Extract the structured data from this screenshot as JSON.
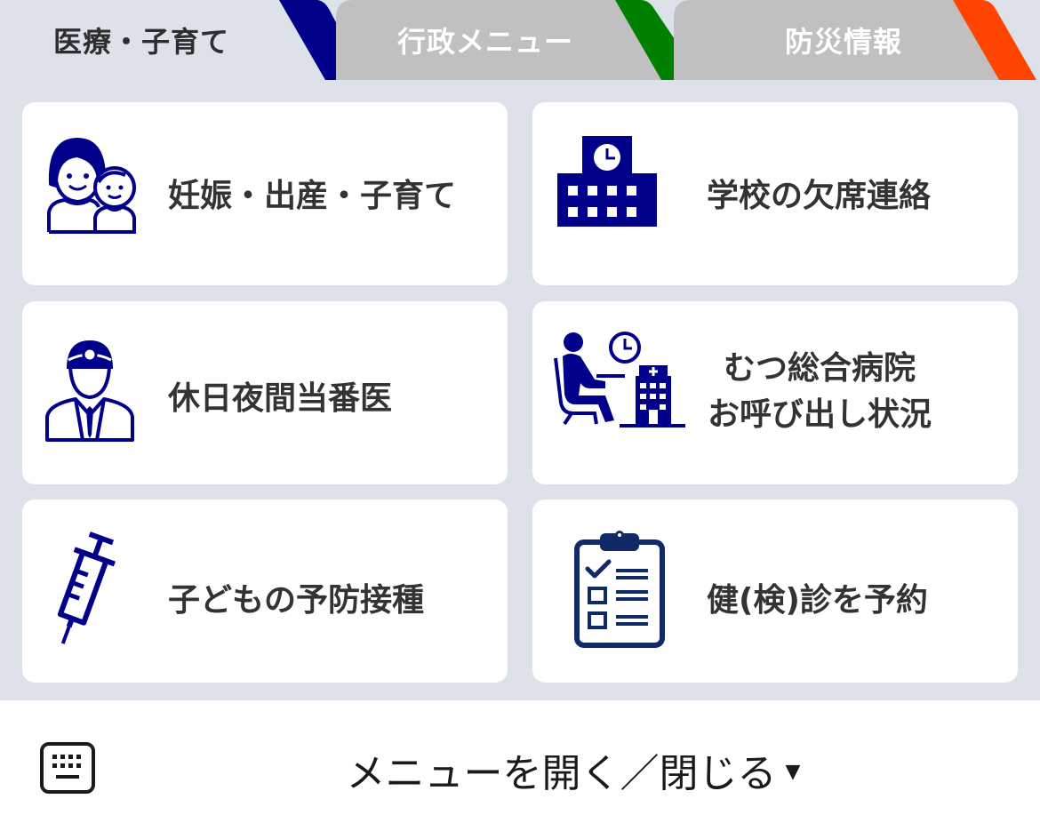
{
  "tabs": [
    {
      "label": "医療・子育て",
      "active": true,
      "accent": "#00008b"
    },
    {
      "label": "行政メニュー",
      "active": false,
      "accent": "#008000"
    },
    {
      "label": "防災情報",
      "active": false,
      "accent": "#ff4500"
    }
  ],
  "colors": {
    "panel_bg": "#dce1ea",
    "tab_inactive": "#c0c0c0",
    "icon": "#00008b",
    "card_bg": "#ffffff",
    "text": "#333333"
  },
  "cards": [
    {
      "label": "妊娠・出産・子育て",
      "icon": "parent-child-icon"
    },
    {
      "label": "学校の欠席連絡",
      "icon": "school-building-icon"
    },
    {
      "label": "休日夜間当番医",
      "icon": "doctor-icon"
    },
    {
      "line1": "むつ総合病院",
      "line2": "お呼び出し状況",
      "icon": "waiting-room-icon"
    },
    {
      "label": "子どもの予防接種",
      "icon": "syringe-icon"
    },
    {
      "label": "健(検)診を予約",
      "icon": "clipboard-checklist-icon"
    }
  ],
  "bottom": {
    "menu_label": "メニューを開く／閉じる",
    "caret": "▼",
    "keyboard_icon": "keyboard-icon"
  }
}
